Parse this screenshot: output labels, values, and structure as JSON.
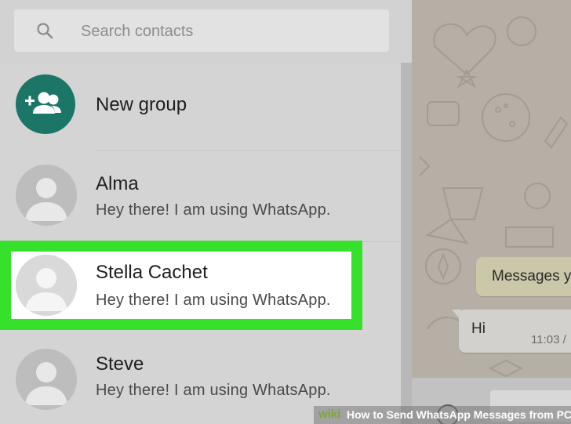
{
  "search": {
    "placeholder": "Search contacts",
    "icon": "search-icon"
  },
  "new_group": {
    "label": "New group",
    "icon": "group-add-icon",
    "icon_bg": "#1c7668"
  },
  "contacts": [
    {
      "name": "Alma",
      "status": "Hey there! I am using WhatsApp."
    },
    {
      "name": "Stella Cachet",
      "status": "Hey there! I am using WhatsApp.",
      "highlighted": true
    },
    {
      "name": "Steve",
      "status": "Hey there! I am using WhatsApp."
    }
  ],
  "chat": {
    "incoming_message": "Messages y",
    "outgoing_message": "Hi",
    "outgoing_time": "11:03 /"
  },
  "watermark": {
    "logo_prefix": "wiki",
    "logo_suffix": "How",
    "title": "How to Send WhatsApp Messages from PC"
  },
  "colors": {
    "highlight": "#35e12b",
    "accent": "#1c7668"
  }
}
